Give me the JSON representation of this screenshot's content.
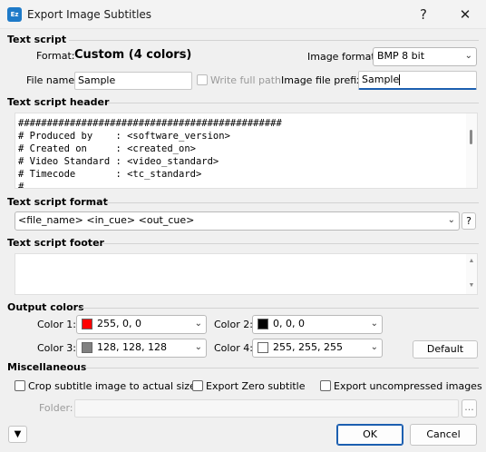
{
  "window": {
    "title": "Export Image Subtitles",
    "app_icon_text": "Ez",
    "help_glyph": "?",
    "close_glyph": "✕"
  },
  "text_script": {
    "section_label": "Text script",
    "format_label": "Format:",
    "format_value": "Custom (4 colors)",
    "image_format_label": "Image format:",
    "image_format_value": "BMP 8 bit",
    "file_name_label": "File name:",
    "file_name_value": "Sample",
    "write_full_path_label": "Write full path",
    "image_prefix_label": "Image file prefix:",
    "image_prefix_value": "Sample"
  },
  "header": {
    "section_label": "Text script header",
    "lines": [
      "##############################################",
      "# Produced by    : <software_version>",
      "# Created on     : <created_on>",
      "# Video Standard : <video_standard>",
      "# Timecode       : <tc_standard>",
      "#"
    ]
  },
  "script_format": {
    "section_label": "Text script format",
    "value": "<file_name> <in_cue> <out_cue>",
    "help_label": "?"
  },
  "footer": {
    "section_label": "Text script footer",
    "value": ""
  },
  "output_colors": {
    "section_label": "Output colors",
    "color1_label": "Color 1:",
    "color1_value": "255, 0, 0",
    "color1_hex": "#ff0000",
    "color2_label": "Color 2:",
    "color2_value": "0, 0, 0",
    "color2_hex": "#000000",
    "color3_label": "Color 3:",
    "color3_value": "128, 128, 128",
    "color3_hex": "#808080",
    "color4_label": "Color 4:",
    "color4_value": "255, 255, 255",
    "color4_hex": "#ffffff",
    "default_button": "Default"
  },
  "misc": {
    "section_label": "Miscellaneous",
    "crop_label": "Crop subtitle image to actual size",
    "export_zero_label": "Export Zero subtitle",
    "export_uncompressed_label": "Export uncompressed images",
    "folder_label": "Folder:",
    "folder_value": "",
    "browse_label": "..."
  },
  "footer_buttons": {
    "expand_glyph": "▼",
    "ok": "OK",
    "cancel": "Cancel"
  },
  "colors": {
    "accent": "#1c5fb0",
    "window_bg": "#f0f0f0"
  }
}
